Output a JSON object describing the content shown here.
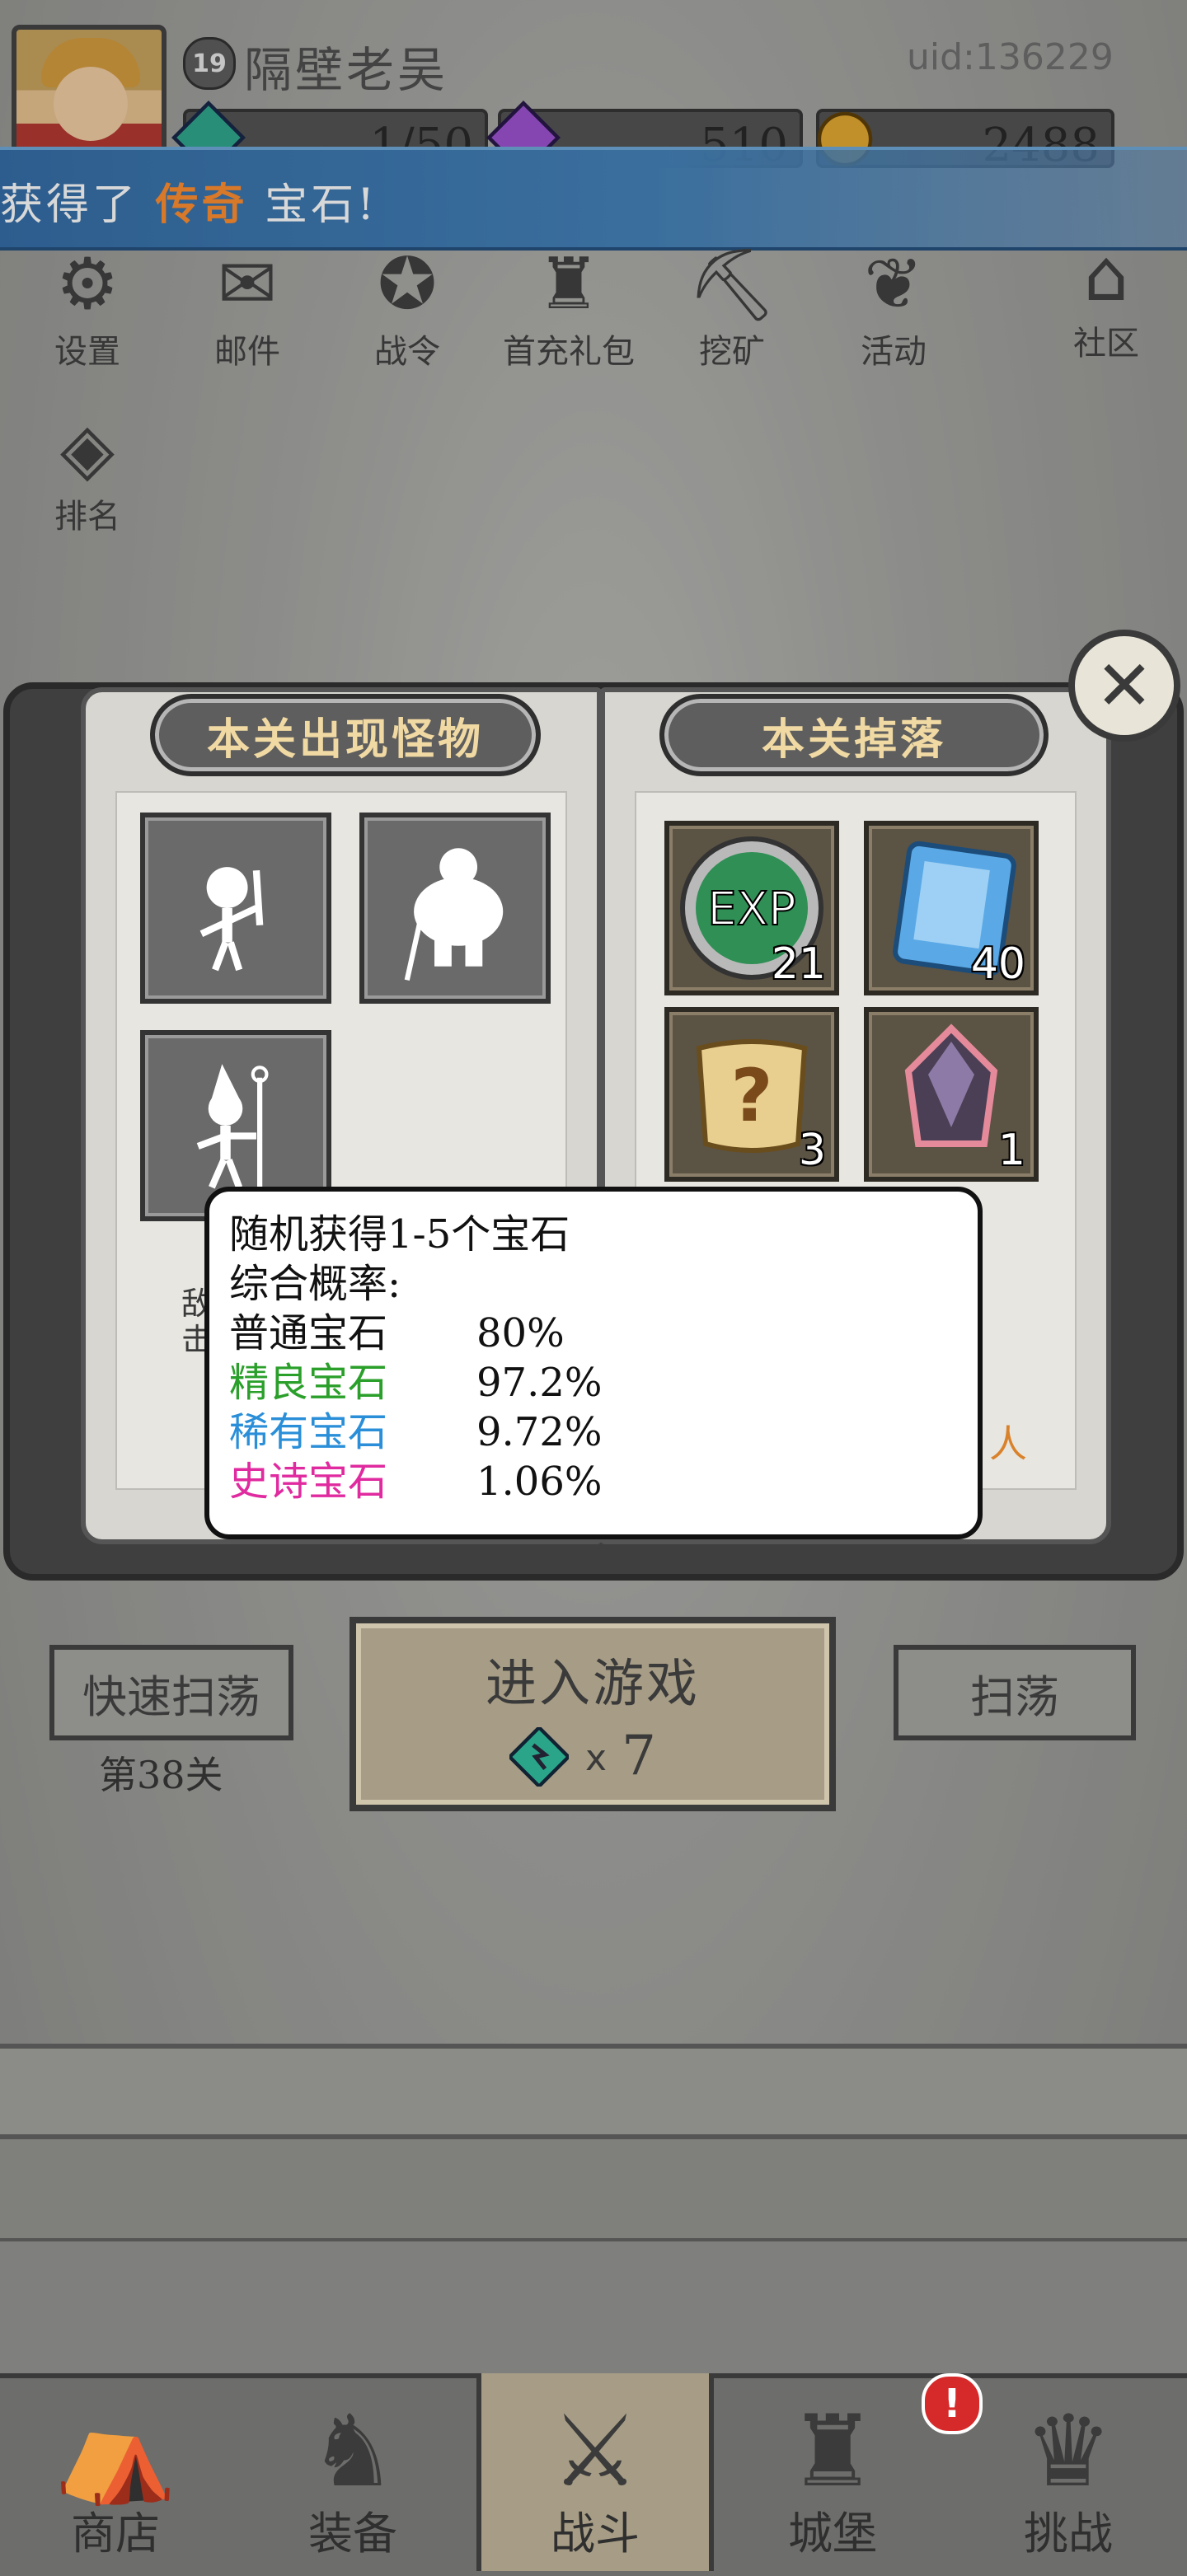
{
  "header": {
    "level": "19",
    "player_name": "隔壁老吴",
    "uid": "uid:136229",
    "resources": [
      {
        "icon": "green-gem-icon",
        "value": "1/50"
      },
      {
        "icon": "purple-gem-icon",
        "value": "510"
      },
      {
        "icon": "gold-coin-icon",
        "value": "2488"
      }
    ]
  },
  "banner": {
    "prefix": "获得了",
    "highlight": "传奇",
    "suffix": "宝石!"
  },
  "top_icons": [
    {
      "icon": "gear-icon",
      "label": "设置"
    },
    {
      "icon": "mail-icon",
      "label": "邮件"
    },
    {
      "icon": "battle-pass-icon",
      "label": "战令"
    },
    {
      "icon": "gift-bag-icon",
      "label": "首充礼包"
    },
    {
      "icon": "mining-icon",
      "label": "挖矿"
    },
    {
      "icon": "laurel-icon",
      "label": "活动"
    },
    {
      "icon": "community-icon",
      "label": "社区"
    },
    {
      "icon": "ranking-icon",
      "label": "排名"
    }
  ],
  "book": {
    "left_title": "本关出现怪物",
    "right_title": "本关掉落",
    "monsters": [
      {
        "icon": "skeleton-swordsman-icon"
      },
      {
        "icon": "brute-knight-icon"
      },
      {
        "icon": "skeleton-mage-icon"
      }
    ],
    "drops": [
      {
        "icon": "exp-orb-icon",
        "count": "21"
      },
      {
        "icon": "blue-crystal-icon",
        "count": "40"
      },
      {
        "icon": "mystery-scroll-icon",
        "count": "3"
      },
      {
        "icon": "legendary-gem-icon",
        "count": "1"
      }
    ],
    "partial_left_text": [
      "敌",
      "击"
    ],
    "partial_right_text": "人"
  },
  "tooltip": {
    "title": "随机获得1-5个宝石",
    "subtitle": "综合概率:",
    "rows": [
      {
        "name": "普通宝石",
        "value": "80%",
        "color": "#111111"
      },
      {
        "name": "精良宝石",
        "value": "97.2%",
        "color": "#2a9f2a"
      },
      {
        "name": "稀有宝石",
        "value": "9.72%",
        "color": "#2a8fd8"
      },
      {
        "name": "史诗宝石",
        "value": "1.06%",
        "color": "#e02a9f"
      }
    ]
  },
  "actions": {
    "quick_sweep": "快速扫荡",
    "stage": "第38关",
    "enter_game": "进入游戏",
    "cost_x": "x",
    "cost_value": "7",
    "sweep": "扫荡"
  },
  "nav": [
    {
      "icon": "shop-icon",
      "label": "商店"
    },
    {
      "icon": "equipment-bag-icon",
      "label": "装备"
    },
    {
      "icon": "crossed-swords-icon",
      "label": "战斗",
      "active": true
    },
    {
      "icon": "castle-icon",
      "label": "城堡",
      "badge": "!"
    },
    {
      "icon": "challenge-helm-icon",
      "label": "挑战"
    }
  ]
}
